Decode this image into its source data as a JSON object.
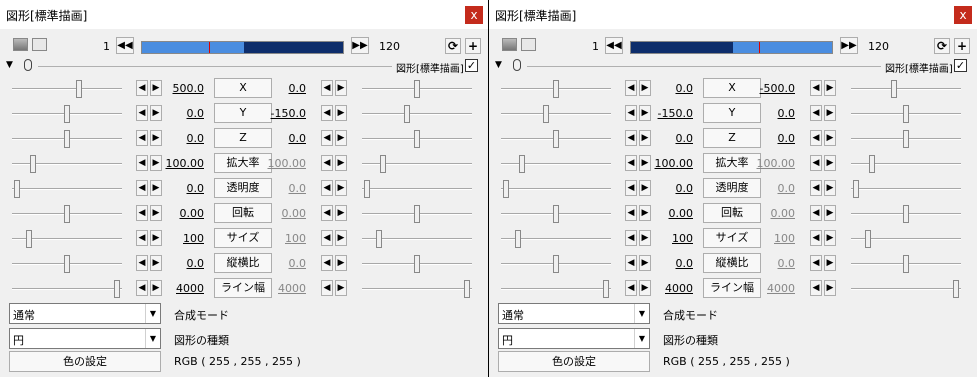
{
  "panels": [
    {
      "title": "図形[標準描画]",
      "close_symbol": "x",
      "frame_start": "1",
      "frame_end": "120",
      "timeline": {
        "before_color": "#4a8de0",
        "after_color": "#0d2d6b",
        "cursor_fraction": 0.33,
        "split_fraction": 0.5
      },
      "prev_symbol": "◀◀",
      "next_symbol": "▶▶",
      "object_label": "図形[標準描画]",
      "checkbox_mark": "✓",
      "params": [
        {
          "label": "X",
          "start": "500.0",
          "end": "0.0",
          "end_grey": false,
          "slider_left": 0.62,
          "slider_right": 0.5
        },
        {
          "label": "Y",
          "start": "0.0",
          "end": "-150.0",
          "end_grey": false,
          "slider_left": 0.5,
          "slider_right": 0.4
        },
        {
          "label": "Z",
          "start": "0.0",
          "end": "0.0",
          "end_grey": false,
          "slider_left": 0.5,
          "slider_right": 0.5
        },
        {
          "label": "拡大率",
          "start": "100.00",
          "end": "100.00",
          "end_grey": true,
          "slider_left": 0.17,
          "slider_right": 0.17
        },
        {
          "label": "透明度",
          "start": "0.0",
          "end": "0.0",
          "end_grey": true,
          "slider_left": 0.02,
          "slider_right": 0.02
        },
        {
          "label": "回転",
          "start": "0.00",
          "end": "0.00",
          "end_grey": true,
          "slider_left": 0.5,
          "slider_right": 0.5
        },
        {
          "label": "サイズ",
          "start": "100",
          "end": "100",
          "end_grey": true,
          "slider_left": 0.13,
          "slider_right": 0.13
        },
        {
          "label": "縦横比",
          "start": "0.0",
          "end": "0.0",
          "end_grey": true,
          "slider_left": 0.5,
          "slider_right": 0.5
        },
        {
          "label": "ライン幅",
          "start": "4000",
          "end": "4000",
          "end_grey": true,
          "slider_left": 0.98,
          "slider_right": 0.98
        }
      ],
      "blend_value": "通常",
      "blend_label": "合成モード",
      "shape_value": "円",
      "shape_label": "図形の種類",
      "color_button": "色の設定",
      "rgb_text": "RGB ( 255 , 255 , 255 )"
    },
    {
      "title": "図形[標準描画]",
      "close_symbol": "x",
      "frame_start": "1",
      "frame_end": "120",
      "timeline": {
        "before_color": "#0d2d6b",
        "after_color": "#4a8de0",
        "cursor_fraction": 0.63,
        "split_fraction": 0.5
      },
      "prev_symbol": "◀◀",
      "next_symbol": "▶▶",
      "object_label": "図形[標準描画]",
      "checkbox_mark": "✓",
      "params": [
        {
          "label": "X",
          "start": "0.0",
          "end": "-500.0",
          "end_grey": false,
          "slider_left": 0.5,
          "slider_right": 0.38
        },
        {
          "label": "Y",
          "start": "-150.0",
          "end": "0.0",
          "end_grey": false,
          "slider_left": 0.4,
          "slider_right": 0.5
        },
        {
          "label": "Z",
          "start": "0.0",
          "end": "0.0",
          "end_grey": false,
          "slider_left": 0.5,
          "slider_right": 0.5
        },
        {
          "label": "拡大率",
          "start": "100.00",
          "end": "100.00",
          "end_grey": true,
          "slider_left": 0.17,
          "slider_right": 0.17
        },
        {
          "label": "透明度",
          "start": "0.0",
          "end": "0.0",
          "end_grey": true,
          "slider_left": 0.02,
          "slider_right": 0.02
        },
        {
          "label": "回転",
          "start": "0.00",
          "end": "0.00",
          "end_grey": true,
          "slider_left": 0.5,
          "slider_right": 0.5
        },
        {
          "label": "サイズ",
          "start": "100",
          "end": "100",
          "end_grey": true,
          "slider_left": 0.13,
          "slider_right": 0.13
        },
        {
          "label": "縦横比",
          "start": "0.0",
          "end": "0.0",
          "end_grey": true,
          "slider_left": 0.5,
          "slider_right": 0.5
        },
        {
          "label": "ライン幅",
          "start": "4000",
          "end": "4000",
          "end_grey": true,
          "slider_left": 0.98,
          "slider_right": 0.98
        }
      ],
      "blend_value": "通常",
      "blend_label": "合成モード",
      "shape_value": "円",
      "shape_label": "図形の種類",
      "color_button": "色の設定",
      "rgb_text": "RGB ( 255 , 255 , 255 )"
    }
  ]
}
